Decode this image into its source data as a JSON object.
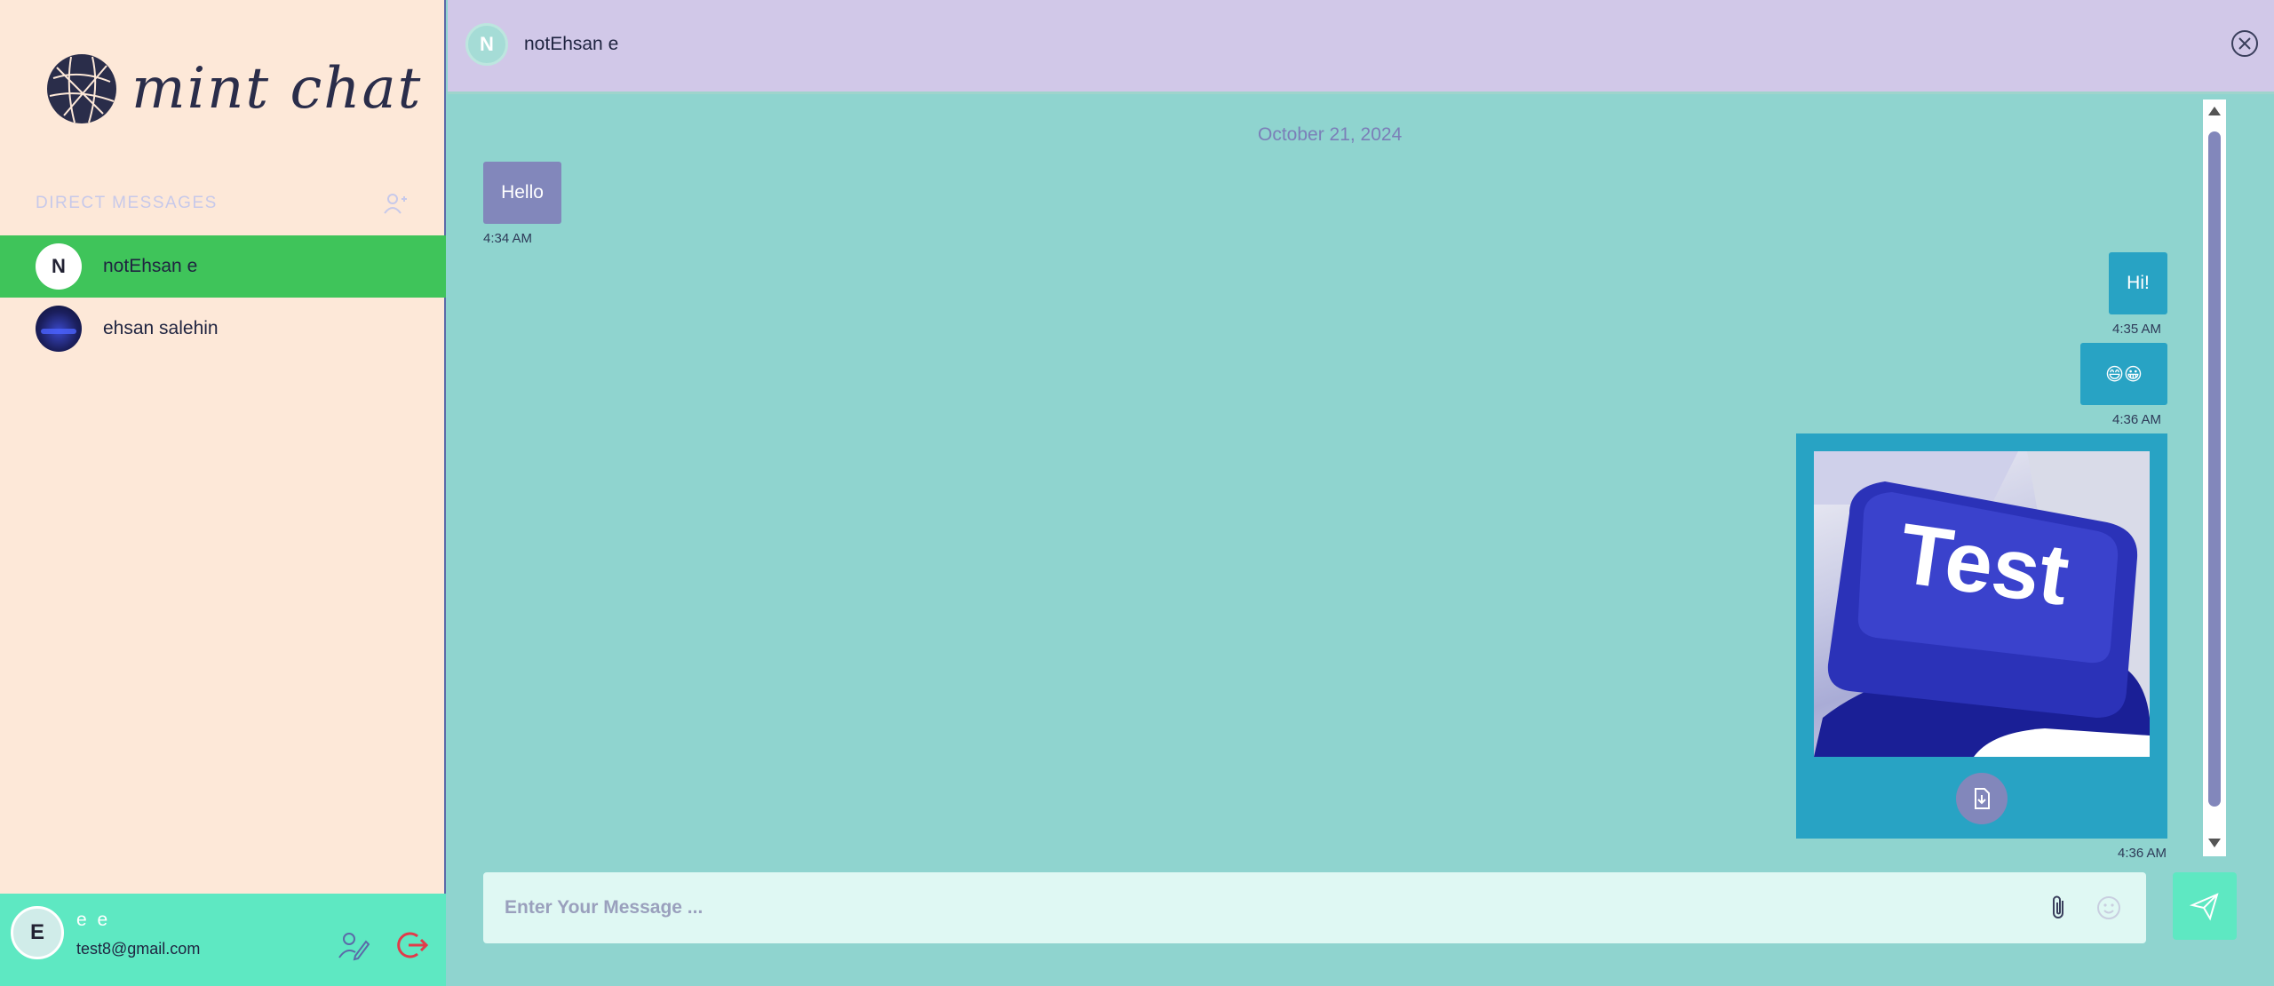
{
  "app": {
    "name": "mint chat"
  },
  "sidebar": {
    "section_title": "DIRECT MESSAGES",
    "contacts": [
      {
        "initial": "N",
        "name": "notEhsan e",
        "active": true
      },
      {
        "initial": "",
        "name": "ehsan salehin",
        "active": false
      }
    ]
  },
  "user": {
    "initial": "E",
    "name": "e e",
    "email": "test8@gmail.com"
  },
  "chat": {
    "contact_initial": "N",
    "contact_name": "notEhsan e",
    "date": "October 21, 2024",
    "messages": [
      {
        "dir": "in",
        "text": "Hello",
        "time": "4:34 AM"
      },
      {
        "dir": "out",
        "text": "Hi!",
        "time": "4:35 AM"
      },
      {
        "dir": "out",
        "text": "😄😀",
        "time": "4:36 AM"
      },
      {
        "dir": "out",
        "image_text": "Test",
        "time": "4:36 AM"
      }
    ]
  },
  "composer": {
    "placeholder": "Enter Your Message ..."
  },
  "colors": {
    "sidebar_bg": "#fde8d8",
    "active_contact": "#3fc45a",
    "chat_bg": "#8fd4cf",
    "topbar": "#d1c8e8",
    "incoming": "#8287bb",
    "outgoing": "#28a3c4",
    "mint": "#5ee8c2"
  }
}
